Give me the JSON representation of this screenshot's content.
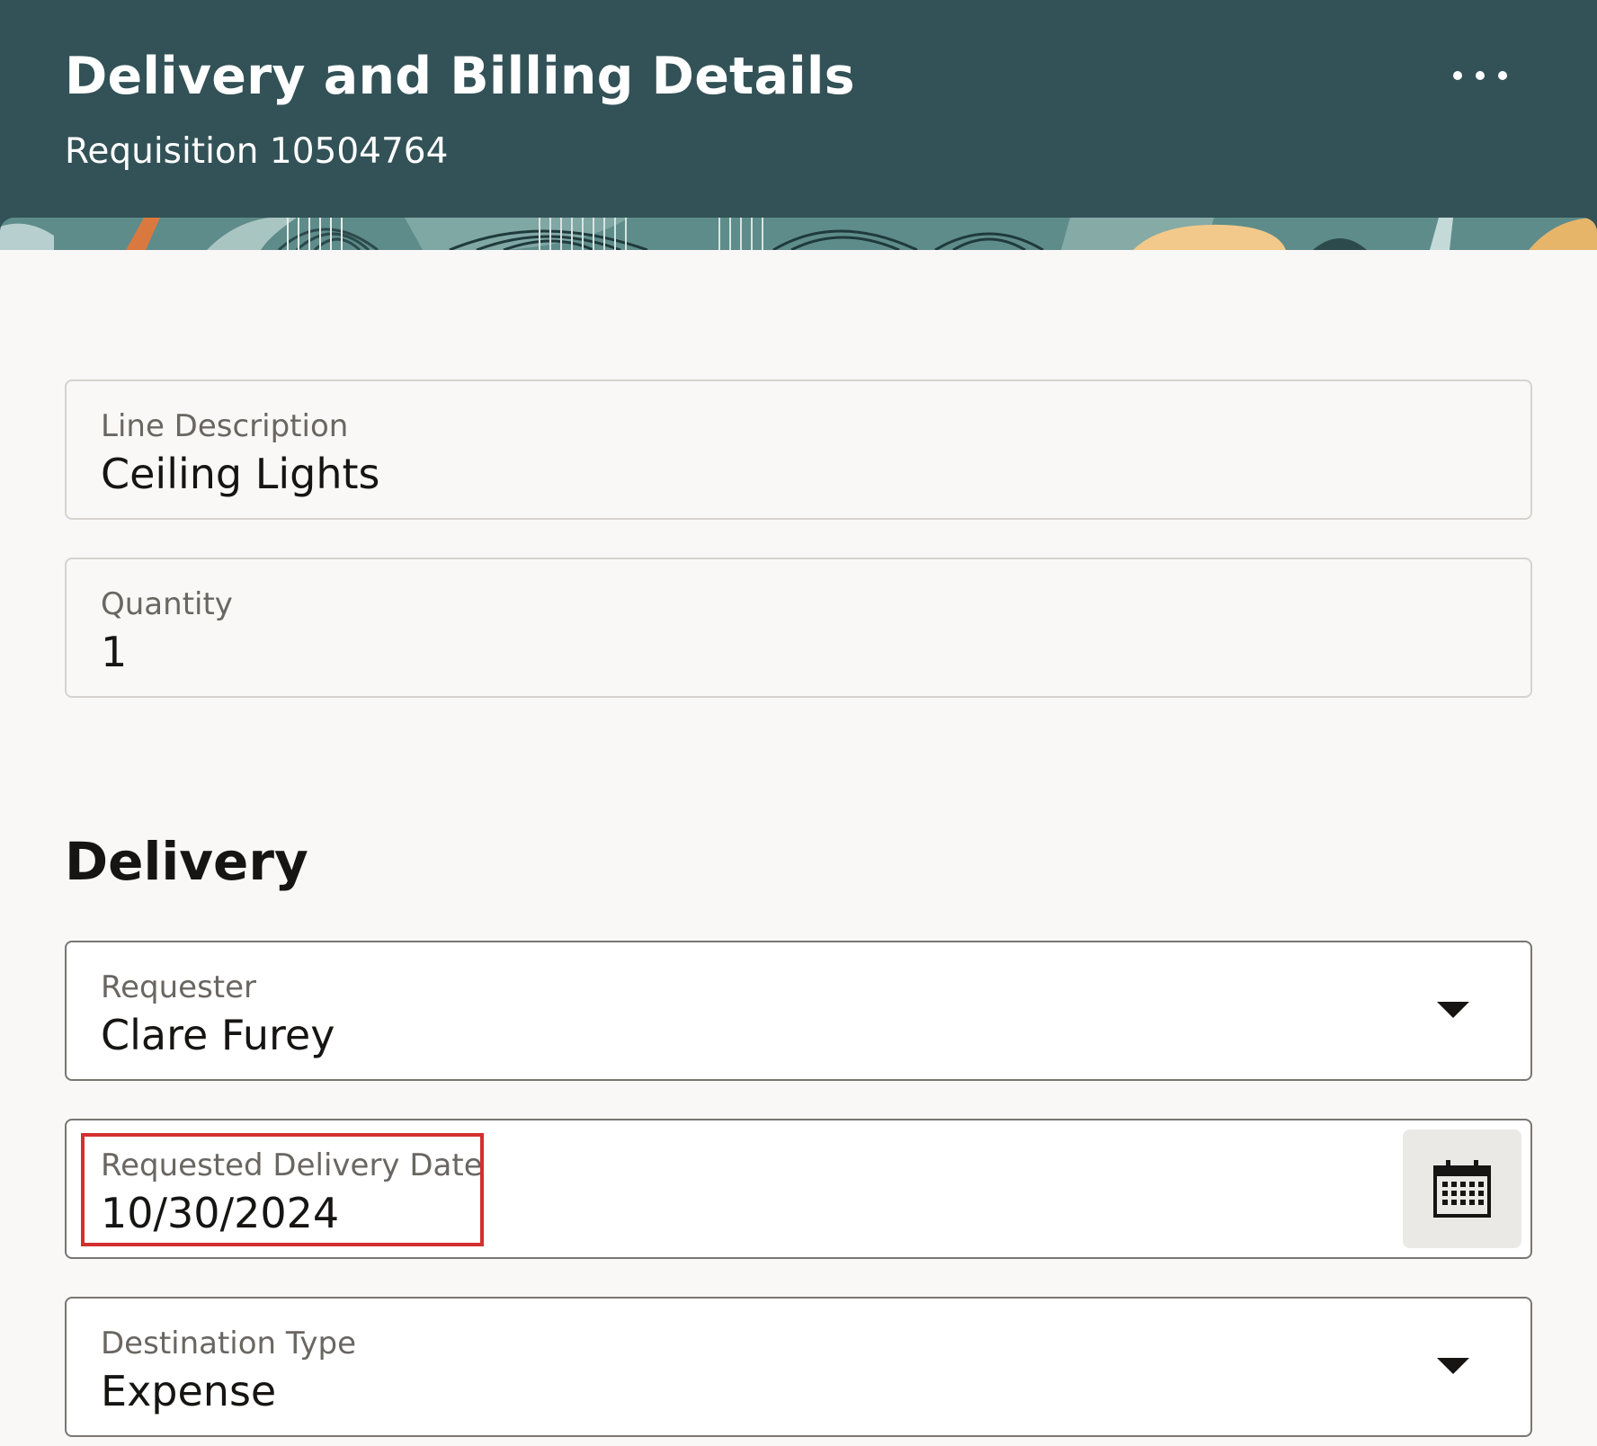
{
  "header": {
    "title": "Delivery and Billing Details",
    "subtitle": "Requisition 10504764",
    "more_icon": "more-horizontal-icon"
  },
  "line_description": {
    "label": "Line Description",
    "value": "Ceiling Lights"
  },
  "quantity": {
    "label": "Quantity",
    "value": "1"
  },
  "delivery": {
    "section_title": "Delivery",
    "requester": {
      "label": "Requester",
      "value": "Clare Furey"
    },
    "requested_delivery_date": {
      "label": "Requested Delivery Date",
      "value": "10/30/2024",
      "icon": "calendar-icon"
    },
    "destination_type": {
      "label": "Destination Type",
      "value": "Expense"
    }
  },
  "colors": {
    "header_bg": "#325257",
    "highlight": "#d32f2f",
    "page_bg": "#f9f8f6"
  }
}
